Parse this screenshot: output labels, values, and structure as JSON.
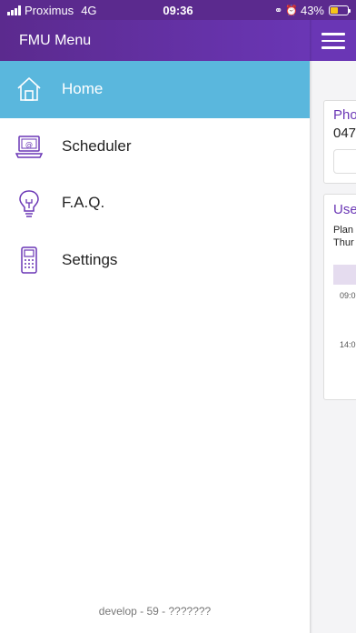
{
  "status_bar": {
    "carrier": "Proximus",
    "network": "4G",
    "time": "09:36",
    "battery_percent": "43%",
    "battery_level": 0.43
  },
  "drawer": {
    "title": "FMU Menu",
    "items": [
      {
        "label": "Home",
        "icon": "home-icon",
        "active": true
      },
      {
        "label": "Scheduler",
        "icon": "laptop-email-icon",
        "active": false
      },
      {
        "label": "F.A.Q.",
        "icon": "lightbulb-icon",
        "active": false
      },
      {
        "label": "Settings",
        "icon": "phone-keypad-icon",
        "active": false
      }
    ],
    "version": "develop - 59 - ???????"
  },
  "background_app": {
    "card1": {
      "title": "Pho",
      "value": "047"
    },
    "card2": {
      "title": "Use",
      "line1": "Plan",
      "line2": "Thur",
      "time1": "09:0",
      "time2": "14:0"
    }
  },
  "colors": {
    "header_purple": "#6a36b5",
    "active_blue": "#5ab7dd",
    "icon_purple": "#6a36b5"
  }
}
